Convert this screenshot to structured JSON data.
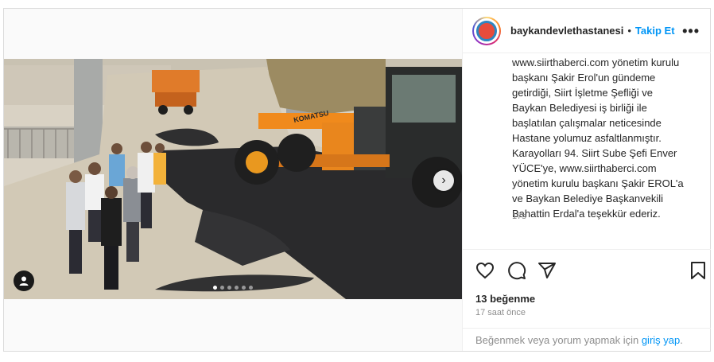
{
  "post": {
    "username": "baykandevlethastanesi",
    "separator": "•",
    "follow_label": "Takip Et",
    "more_label": "•••",
    "caption_lines": [
      "www.siirthaberci.com yönetim kurulu",
      "başkanı Şakir Erol'un gündeme",
      "getirdiği, Siirt İşletme Şefliği ve",
      "Baykan Belediyesi iş birliği ile",
      "başlatılan çalışmalar neticesinde",
      "Hastane yolumuz asfaltlanmıştır.",
      "Karayolları 94. Siirt Sube Şefi Enver",
      "YÜCE'ye, www.siirthaberci.com",
      "yönetim kurulu başkanı Şakir EROL'a",
      "ve Baykan Belediye Başkanvekili",
      "Bahattin Erdal'a teşekkür ederiz."
    ],
    "caption_time": "17s",
    "likes": "13 beğenme",
    "posted_ago": "17 saat önce",
    "login_prompt": "Beğenmek veya yorum yapmak için",
    "login_link": "giriş yap",
    "login_suffix": "."
  },
  "media": {
    "next_arrow": "›",
    "carousel_count": 6,
    "carousel_active": 0,
    "photo_text": "KOMATSU"
  },
  "icons": {
    "like": "heart-icon",
    "comment": "comment-icon",
    "share": "share-icon",
    "save": "bookmark-icon",
    "tag": "user-tag-icon",
    "next": "chevron-right-icon"
  },
  "colors": {
    "link": "#0095f6",
    "text": "#262626",
    "muted": "#8e8e8e",
    "border": "#dbdbdb"
  }
}
